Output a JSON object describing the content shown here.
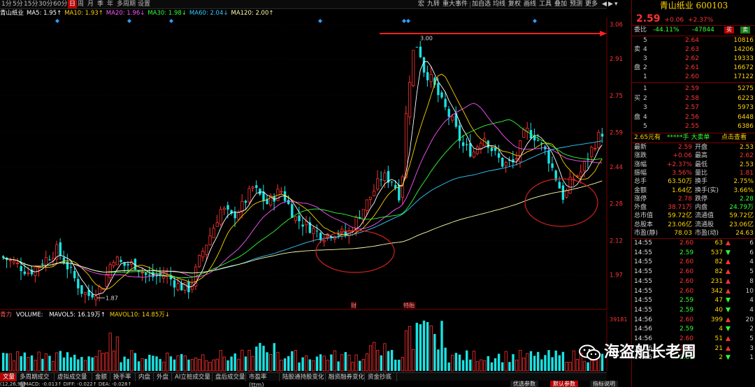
{
  "toolbar": {
    "periods": [
      "1分",
      "5分",
      "15分",
      "30分",
      "60分",
      "日",
      "周",
      "月",
      "季",
      "年",
      "多周期",
      "设置"
    ],
    "active_period": "日",
    "right_tools": [
      "宏",
      "九转",
      "重大事件",
      "加自选",
      "均线",
      "复权",
      "画线",
      "工具",
      "叠加",
      "预测",
      "更多"
    ],
    "window_controls": [
      "◀",
      "▶",
      "▾"
    ]
  },
  "ma_legend": {
    "name": "青山纸业",
    "items": [
      {
        "label": "MA5:",
        "value": "1.95↑",
        "color": "#ffffff"
      },
      {
        "label": "MA10:",
        "value": "1.93↑",
        "color": "#ffd200"
      },
      {
        "label": "MA20:",
        "value": "1.96↓",
        "color": "#ff55ff"
      },
      {
        "label": "MA30:",
        "value": "1.98↓",
        "color": "#33ff33"
      },
      {
        "label": "MA60:",
        "value": "2.04↓",
        "color": "#33ccff"
      },
      {
        "label": "MA120:",
        "value": "2.00↑",
        "color": "#ffffaa"
      }
    ]
  },
  "chart_data": {
    "type": "candlestick",
    "price_axis_ticks": [
      "3.06",
      "2.91",
      "2.75",
      "2.59",
      "2.44",
      "2.28",
      "2.12",
      "1.97"
    ],
    "ylim": [
      1.82,
      3.09
    ],
    "annotations": [
      {
        "text": "3.00",
        "kind": "high"
      },
      {
        "text": "1.87",
        "kind": "low"
      },
      {
        "text": "财",
        "kind": "event"
      },
      {
        "text": "特融",
        "kind": "event"
      }
    ],
    "volume_axis_ticks": [
      "39181"
    ],
    "colors": {
      "up": "#ff3030",
      "down": "#19e3e3",
      "ma5": "#ffffff",
      "ma10": "#ffd200",
      "ma20": "#ff55ff",
      "ma30": "#33ff33",
      "ma60": "#33ccff",
      "ma120": "#ffffaa"
    }
  },
  "volume_legend": {
    "title": "青力",
    "items": [
      "VOLUME: ",
      "MAVOL5: 16.19万↑",
      "MAVOL10: 14.85万↓"
    ]
  },
  "indicator_tabs": [
    "文量",
    "多周期成交量",
    "虚拟成交量",
    "金额",
    "换手率",
    "内盘",
    "外盘",
    "AI立桩成交量",
    "盘后成交量",
    "市盈率(ttm)",
    "陆股通持股变化",
    "融资融券变化",
    "资金抄底"
  ],
  "active_indicator_tab": "文量",
  "macd_line": "(12,26,9) MACD: -0.013↑ DIFF: -0.022↑ DEA: -0.028↑",
  "quote": {
    "title": "青山纸业 600103",
    "price": "2.59",
    "change": "+0.06",
    "change_pct": "+2.37%",
    "webi_label": "委比",
    "webi_pct": "-44.11%",
    "webi_val": "-47844",
    "sell_btn": "买",
    "buy_btn": "卖",
    "asks": [
      {
        "lvl": "5",
        "price": "2.64",
        "vol": "10816"
      },
      {
        "lvl": "4",
        "price": "2.63",
        "vol": "14206"
      },
      {
        "lvl": "3",
        "price": "2.62",
        "vol": "19333"
      },
      {
        "lvl": "2",
        "price": "2.61",
        "vol": "16672"
      },
      {
        "lvl": "1",
        "price": "2.60",
        "vol": "17122"
      }
    ],
    "bids": [
      {
        "lvl": "1",
        "price": "2.59",
        "vol": "5275"
      },
      {
        "lvl": "2",
        "price": "2.58",
        "vol": "6223"
      },
      {
        "lvl": "3",
        "price": "2.57",
        "vol": "5973"
      },
      {
        "lvl": "4",
        "price": "2.56",
        "vol": "6448"
      },
      {
        "lvl": "5",
        "price": "2.55",
        "vol": "6386"
      }
    ],
    "ask_side_label": [
      "卖",
      "盘"
    ],
    "bid_side_label": [
      "买",
      "盘"
    ],
    "big_order": {
      "left": "2.65元有",
      "mid": "*****手 大卖单",
      "right": "点击查看"
    },
    "stats": [
      [
        "最新",
        "2.59",
        "开盘",
        "2.53"
      ],
      [
        "涨跌",
        "+0.06",
        "最高",
        "2.62"
      ],
      [
        "涨幅",
        "+2.37%",
        "最低",
        "2.53"
      ],
      [
        "振幅",
        "3.56%",
        "量比",
        "1.81"
      ],
      [
        "总手",
        "63.50万",
        "换手",
        "2.75%"
      ],
      [
        "金额",
        "1.64亿",
        "换手(实)",
        "3.66%"
      ],
      [
        "涨停",
        "2.78",
        "跌停",
        "2.28"
      ],
      [
        "外盘",
        "38.71万",
        "内盘",
        "24.79万"
      ],
      [
        "总市值",
        "59.72亿",
        "流通值",
        "59.72亿"
      ],
      [
        "总股本",
        "23.06亿",
        "流通股",
        "23.06亿"
      ],
      [
        "市盈(静)",
        "78.03",
        "市盈(动)",
        "24.63"
      ]
    ],
    "ticks": [
      {
        "t": "14:55",
        "p": "2.60",
        "v": "63",
        "dir": "up",
        "n": "6"
      },
      {
        "t": "14:55",
        "p": "2.59",
        "v": "537",
        "dir": "down",
        "n": "6"
      },
      {
        "t": "14:55",
        "p": "2.60",
        "v": "82",
        "dir": "up",
        "n": "4"
      },
      {
        "t": "14:55",
        "p": "2.60",
        "v": "82",
        "dir": "up",
        "n": "5"
      },
      {
        "t": "14:55",
        "p": "2.60",
        "v": "231",
        "dir": "up",
        "n": "8"
      },
      {
        "t": "14:55",
        "p": "2.60",
        "v": "342",
        "dir": "up",
        "n": "10"
      },
      {
        "t": "14:55",
        "p": "2.59",
        "v": "47",
        "dir": "down",
        "n": "4"
      },
      {
        "t": "14:55",
        "p": "2.59",
        "v": "40",
        "dir": "down",
        "n": "4"
      },
      {
        "t": "14:56",
        "p": "2.60",
        "v": "399",
        "dir": "up",
        "n": "20"
      },
      {
        "t": "14:56",
        "p": "2.59",
        "v": "4",
        "dir": "down",
        "n": "2"
      },
      {
        "t": "14:56",
        "p": "2.60",
        "v": "51",
        "dir": "up",
        "n": "5"
      },
      {
        "t": "14:56",
        "p": "2.60",
        "v": "21",
        "dir": "up",
        "n": "3"
      },
      {
        "t": "14:56",
        "p": "2.59",
        "v": "2",
        "dir": "down",
        "n": "1"
      }
    ],
    "bottom_buttons": [
      "优选参数",
      "默认参数",
      "指标说明"
    ]
  },
  "watermark": "海盗船长老周"
}
